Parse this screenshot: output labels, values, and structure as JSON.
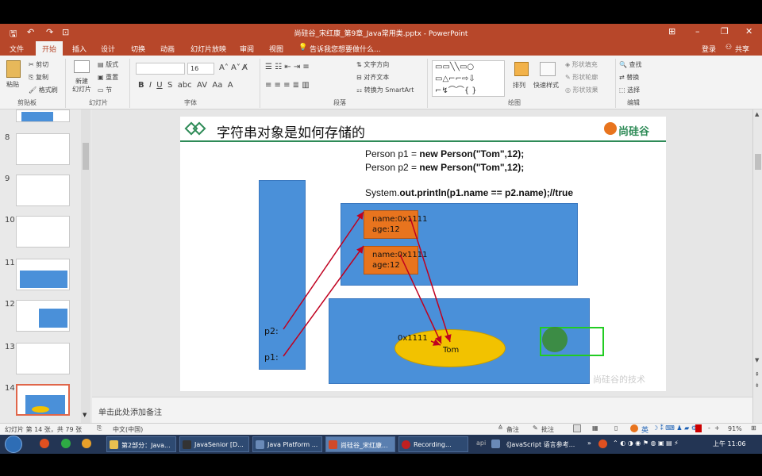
{
  "titlebar": {
    "title": "尚硅谷_宋红康_第9章_Java常用类.pptx - PowerPoint",
    "quick_save": "🖫",
    "quick_undo": "↶",
    "quick_redo": "↷",
    "quick_present": "⊡",
    "ribbon_display": "⊞",
    "minimize": "–",
    "restore": "❐",
    "close": "✕"
  },
  "menu": {
    "file": "文件",
    "home": "开始",
    "insert": "插入",
    "design": "设计",
    "transitions": "切换",
    "animations": "动画",
    "slideshow": "幻灯片放映",
    "review": "审阅",
    "view": "视图",
    "tell_me": "告诉我您想要做什么...",
    "login": "登录",
    "share": "共享"
  },
  "ribbon": {
    "clipboard": {
      "paste": "粘贴",
      "cut": "剪切",
      "copy": "复制",
      "format_painter": "格式刷",
      "label": "剪贴板"
    },
    "slides": {
      "new_slide": "新建\n幻灯片",
      "layout": "版式",
      "reset": "重置",
      "section": "节",
      "label": "幻灯片"
    },
    "font": {
      "size": "16",
      "label": "字体"
    },
    "paragraph": {
      "text_direction": "文字方向",
      "align_text": "对齐文本",
      "smartart": "转换为 SmartArt",
      "label": "段落"
    },
    "drawing": {
      "arrange": "排列",
      "quick_styles": "快速样式",
      "shape_fill": "形状填充",
      "shape_outline": "形状轮廓",
      "shape_effects": "形状效果",
      "label": "绘图"
    },
    "editing": {
      "find": "查找",
      "replace": "替换",
      "select": "选择",
      "label": "编辑"
    }
  },
  "thumbnails": {
    "numbers": [
      "8",
      "9",
      "10",
      "11",
      "12",
      "13",
      "14"
    ],
    "selected": "14"
  },
  "slide": {
    "title": "字符串对象是如何存储的",
    "logo": "尚硅谷",
    "code_line1_a": "Person p1 = ",
    "code_line1_b": "new Person(\"Tom\",12);",
    "code_line2_a": "Person p2 = ",
    "code_line2_b": "new Person(\"Tom\",12);",
    "code_line3_a": "System.",
    "code_line3_b": "out.println(p1.name == p2.name);//true",
    "obj1_name": "name:0x1111",
    "obj1_age": "age:12",
    "obj2_name": "name:0x1111",
    "obj2_age": "age:12",
    "p2_label": "p2:",
    "p1_label": "p1:",
    "addr_label": "0x1111",
    "pool_value": "Tom",
    "watermark": "尚硅谷的技术"
  },
  "notes": {
    "placeholder": "单击此处添加备注"
  },
  "status": {
    "slide_info": "幻灯片 第 14 张，共 79 张",
    "language": "中文(中国)",
    "notes_btn": "备注",
    "comments_btn": "批注",
    "zoom": "91%"
  },
  "taskbar": {
    "items": [
      "第2部分：Java...",
      "JavaSenior [D...",
      "Java Platform ...",
      "尚硅谷_宋红康...",
      "Recording...",
      "《JavaScript 语言参考..."
    ],
    "api_label": "api",
    "ime": "英",
    "time": "上午 11:06"
  },
  "colors": {
    "accent": "#b7472a",
    "slide_green": "#2e8b57",
    "box_blue": "#4a90d9",
    "object_orange": "#e8741e",
    "pool_yellow": "#f2c200",
    "arrow_red": "#c0001f"
  }
}
